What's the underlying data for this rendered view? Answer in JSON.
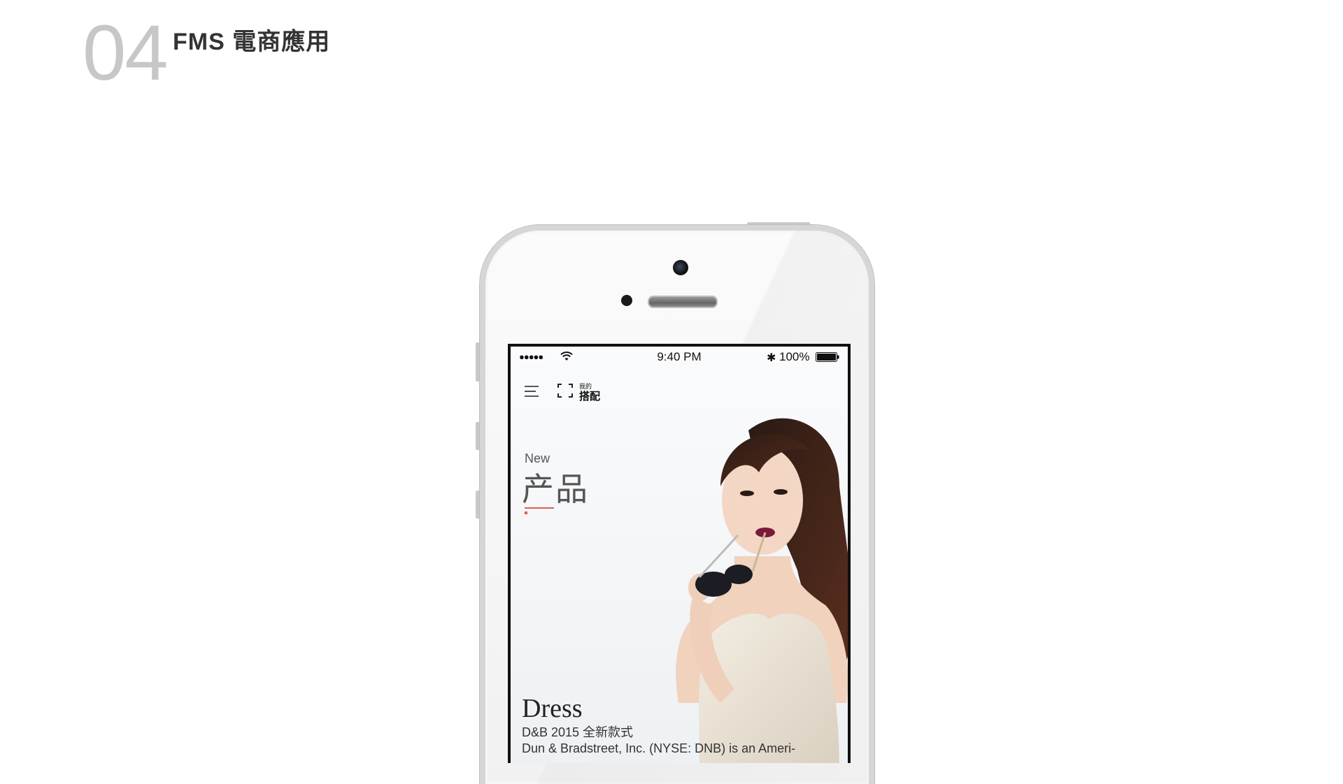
{
  "header": {
    "section_number": "04",
    "section_title": "FMS 電商應用"
  },
  "status_bar": {
    "signal": "●●●●●",
    "time": "9:40 PM",
    "bluetooth": "✱",
    "battery_percent": "100%",
    "battery_level": 1.0
  },
  "app_bar": {
    "menu_icon": "hamburger-menu-icon",
    "scan_icon": "scan-frame-icon",
    "mine_label_small": "我的",
    "mine_label_big": "搭配"
  },
  "hero": {
    "eyebrow": "New",
    "title_cn": "产品",
    "accent_color": "#e25a55"
  },
  "product": {
    "title": "Dress",
    "subtitle": "D&B 2015 全新款式",
    "description": "Dun & Bradstreet, Inc. (NYSE: DNB) is an Ameri-",
    "description_cont": "…"
  }
}
